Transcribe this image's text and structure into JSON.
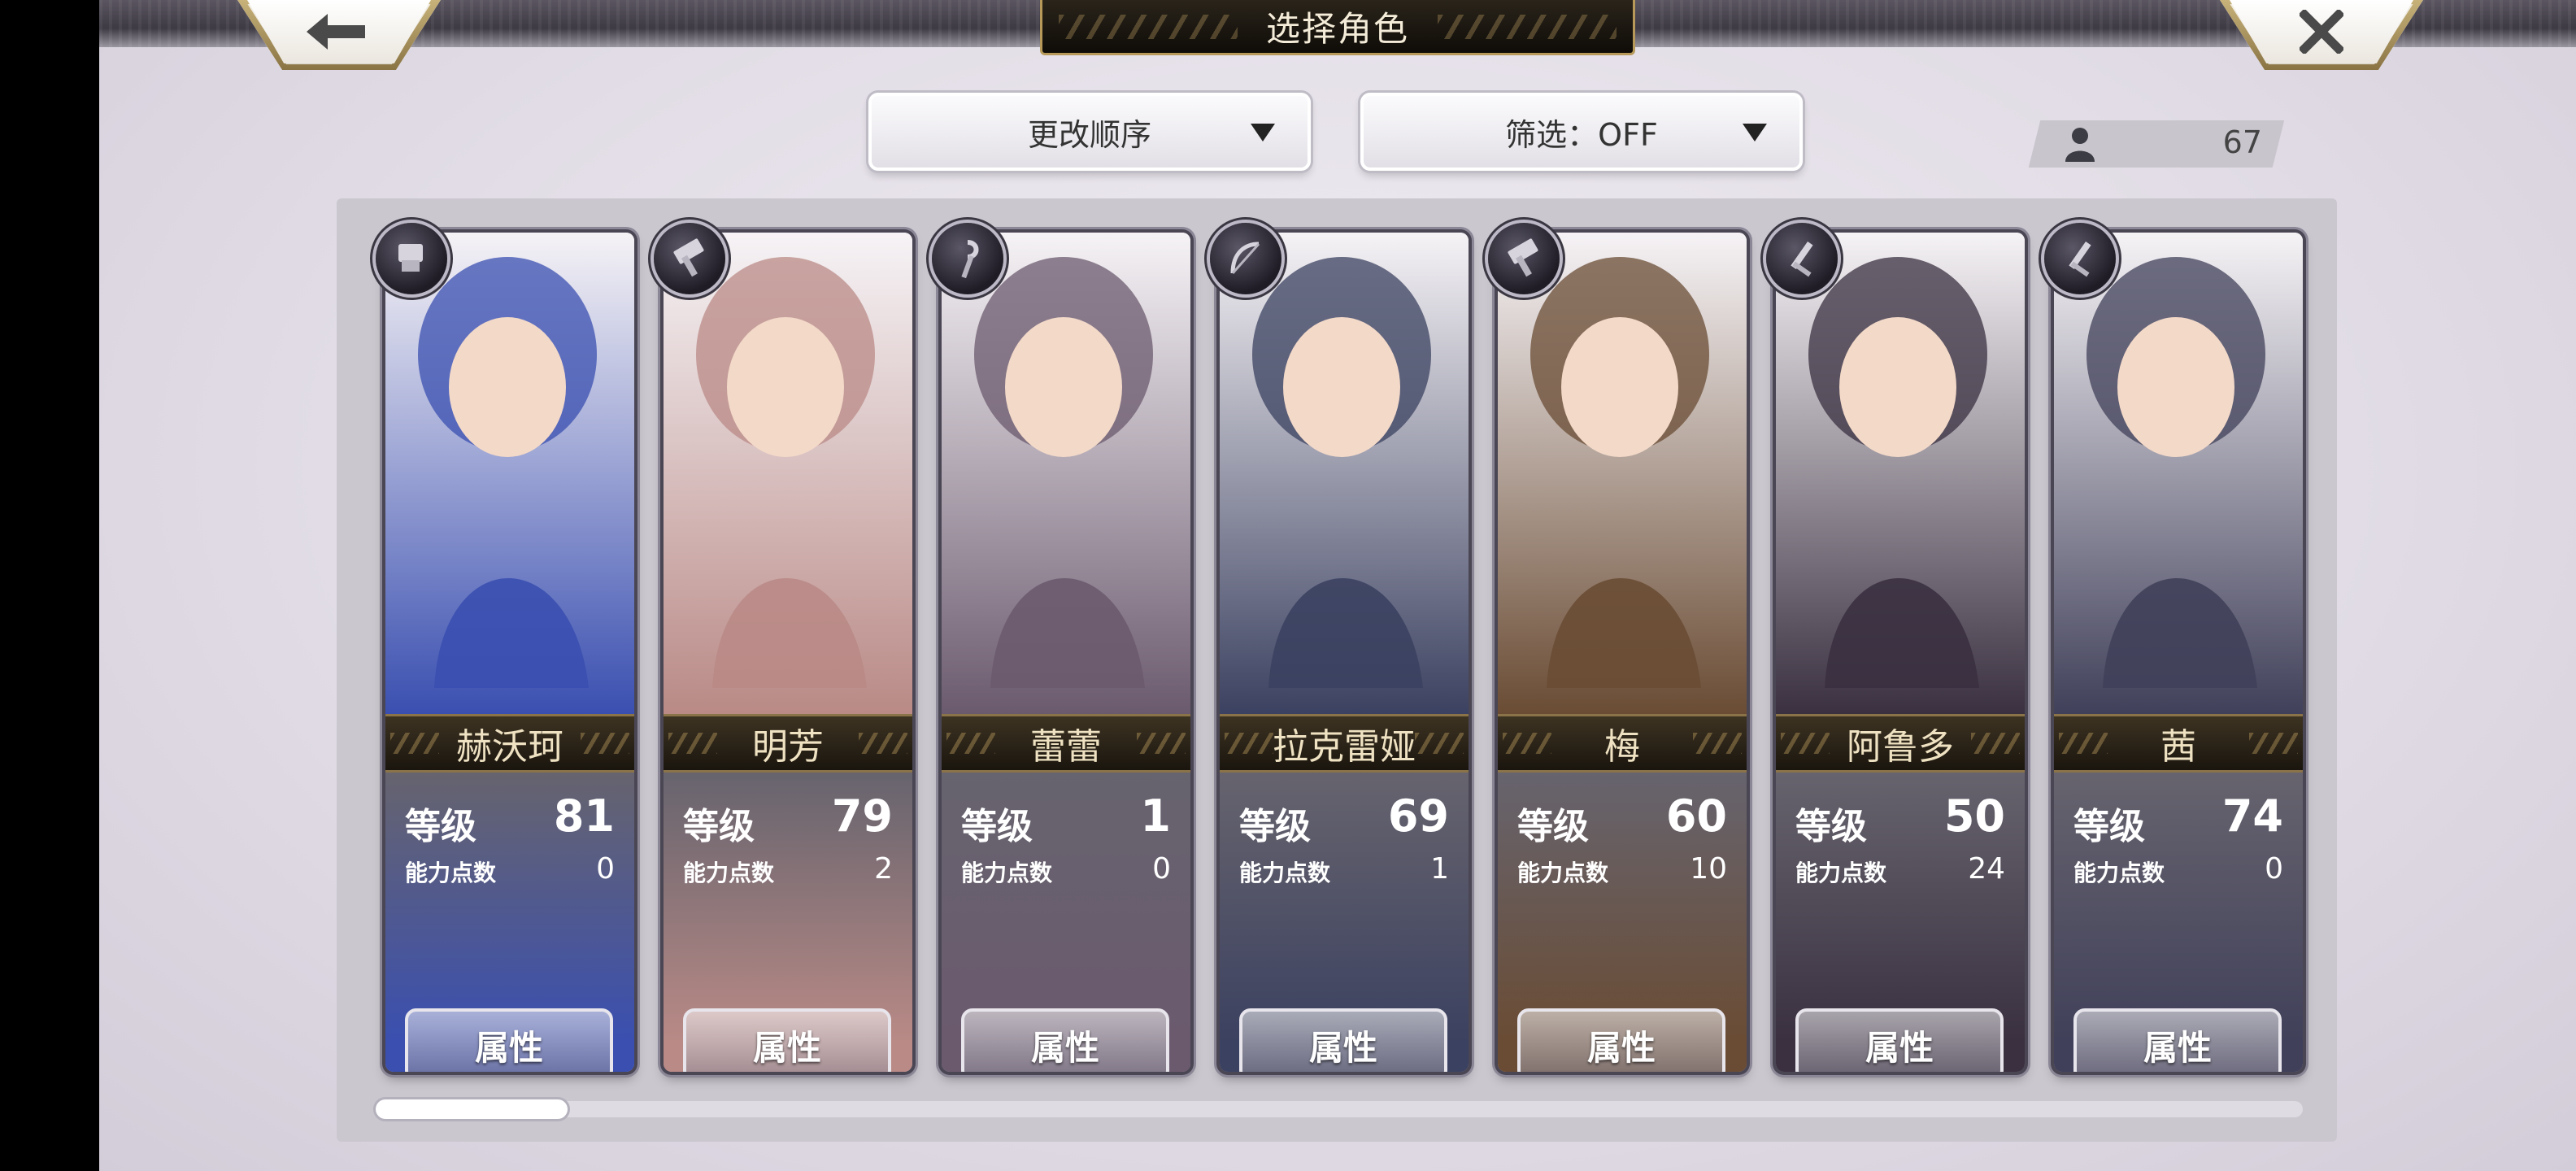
{
  "header": {
    "title": "选择角色",
    "back_icon": "arrow-left-icon",
    "close_icon": "close-x-icon"
  },
  "controls": {
    "sort_label": "更改顺序",
    "filter_label": "筛选：OFF",
    "character_count": "67"
  },
  "labels": {
    "level": "等级",
    "ability_points": "能力点数",
    "attribute_button": "属性"
  },
  "characters": [
    {
      "name": "赫沃珂",
      "level": "81",
      "ability_points": "0",
      "class_icon": "gauntlet-icon",
      "theme": "#3a4fb0"
    },
    {
      "name": "明芳",
      "level": "79",
      "ability_points": "2",
      "class_icon": "hammer-icon",
      "theme": "#b98a86"
    },
    {
      "name": "蕾蕾",
      "level": "1",
      "ability_points": "0",
      "class_icon": "staff-icon",
      "theme": "#6b5a6e"
    },
    {
      "name": "拉克雷娅",
      "level": "69",
      "ability_points": "1",
      "class_icon": "bow-icon",
      "theme": "#3b4160"
    },
    {
      "name": "梅",
      "level": "60",
      "ability_points": "10",
      "class_icon": "hammer-icon",
      "theme": "#6a4c34"
    },
    {
      "name": "阿鲁多",
      "level": "50",
      "ability_points": "24",
      "class_icon": "sword-icon",
      "theme": "#3a3040"
    },
    {
      "name": "茜",
      "level": "74",
      "ability_points": "0",
      "class_icon": "sword-icon",
      "theme": "#40405a"
    }
  ]
}
